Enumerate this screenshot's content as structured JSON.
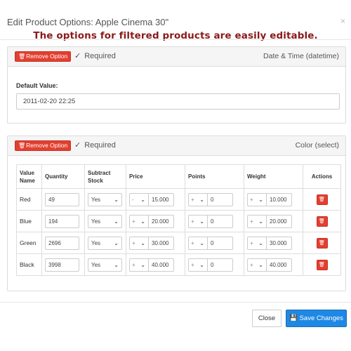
{
  "modal": {
    "title": "Edit Product Options: Apple Cinema 30\"",
    "close_glyph": "×"
  },
  "banner": "The options for filtered products are easily editable.",
  "colors": {
    "danger": "#e2402f",
    "primary": "#1e88e5",
    "banner_text": "#8b1a1a"
  },
  "options": [
    {
      "remove_label": "Remove Option",
      "remove_icon": "trash-icon",
      "required_label": "Required",
      "type_label": "Date & Time (datetime)",
      "default_value_label": "Default Value:",
      "default_value": "2011-02-20 22:25"
    },
    {
      "remove_label": "Remove Option",
      "remove_icon": "trash-icon",
      "required_label": "Required",
      "type_label": "Color (select)",
      "columns": [
        "Value Name",
        "Quantity",
        "Subtract Stock",
        "Price",
        "Points",
        "Weight",
        "Actions"
      ],
      "rows": [
        {
          "name": "Red",
          "quantity": "49",
          "subtract": "Yes",
          "price_prefix": "-",
          "price": "15.000",
          "points_prefix": "+",
          "points": "0",
          "weight_prefix": "+",
          "weight": "10.000"
        },
        {
          "name": "Blue",
          "quantity": "194",
          "subtract": "Yes",
          "price_prefix": "+",
          "price": "20.000",
          "points_prefix": "+",
          "points": "0",
          "weight_prefix": "+",
          "weight": "20.000"
        },
        {
          "name": "Green",
          "quantity": "2696",
          "subtract": "Yes",
          "price_prefix": "+",
          "price": "30.000",
          "points_prefix": "+",
          "points": "0",
          "weight_prefix": "+",
          "weight": "30.000"
        },
        {
          "name": "Black",
          "quantity": "3998",
          "subtract": "Yes",
          "price_prefix": "+",
          "price": "40.000",
          "points_prefix": "+",
          "points": "0",
          "weight_prefix": "+",
          "weight": "40.000"
        }
      ]
    }
  ],
  "footer": {
    "close_label": "Close",
    "save_label": "Save Changes",
    "save_icon": "save-icon"
  }
}
